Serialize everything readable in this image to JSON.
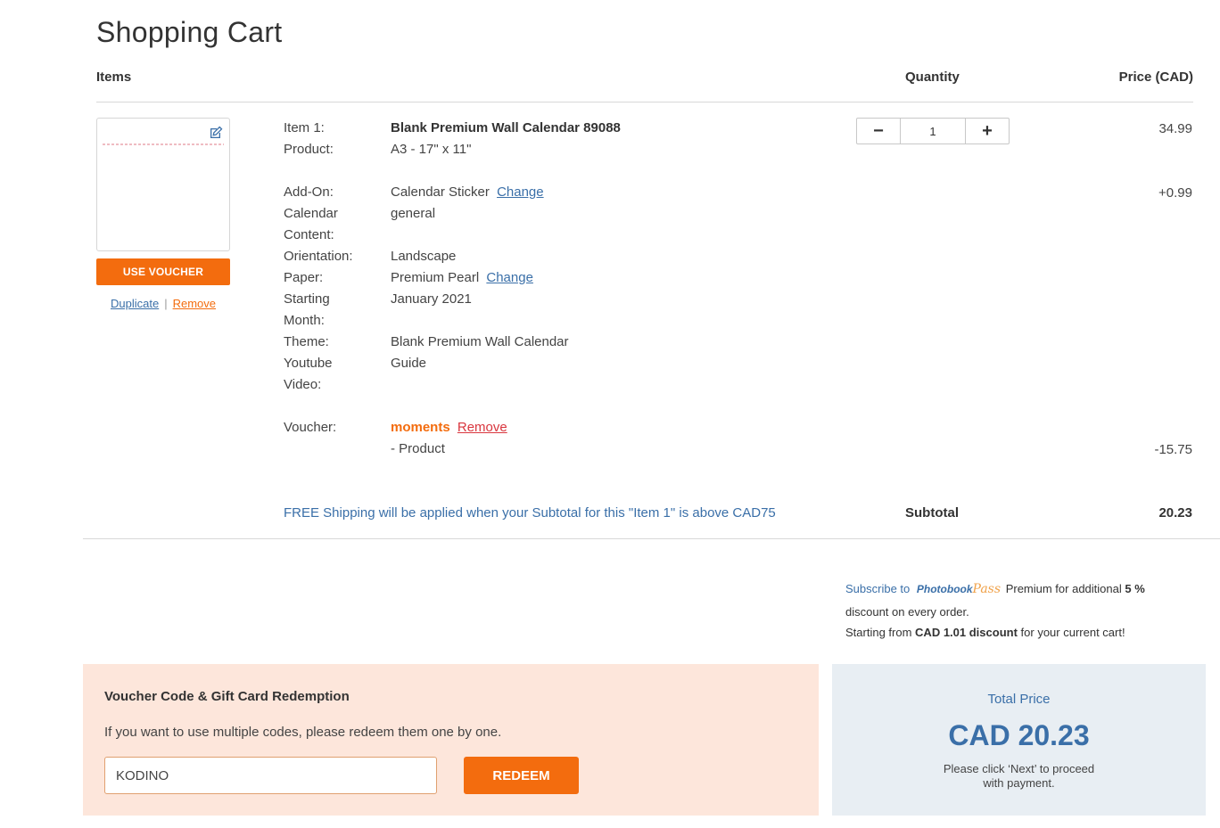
{
  "page": {
    "title": "Shopping Cart"
  },
  "table_headers": {
    "items": "Items",
    "quantity": "Quantity",
    "price": "Price (CAD)"
  },
  "item": {
    "actions": {
      "use_voucher": "USE VOUCHER",
      "duplicate": "Duplicate",
      "separator": "|",
      "remove": "Remove"
    },
    "item_label": "Item 1:",
    "item_name": "Blank Premium Wall Calendar 89088",
    "product_label": "Product:",
    "product_value": "A3 - 17\" x 11\"",
    "addon_label": "Add-On:",
    "addon_value": "Calendar Sticker",
    "addon_change": "Change",
    "calendar_content_label_1": "Calendar",
    "calendar_content_label_2": "Content:",
    "calendar_content_value": "general",
    "orientation_label": "Orientation:",
    "orientation_value": "Landscape",
    "paper_label": "Paper:",
    "paper_value": "Premium Pearl",
    "paper_change": "Change",
    "starting_month_label_1": "Starting",
    "starting_month_label_2": "Month:",
    "starting_month_value": "January 2021",
    "theme_label": "Theme:",
    "theme_value": "Blank Premium Wall Calendar",
    "youtube_label_1": "Youtube",
    "youtube_label_2": "Video:",
    "youtube_value": "Guide",
    "voucher_label": "Voucher:",
    "voucher_code": "moments",
    "voucher_remove": "Remove",
    "voucher_applies": "- Product",
    "quantity": {
      "minus": "−",
      "value": "1",
      "plus": "+"
    },
    "prices": {
      "base": "34.99",
      "addon": "+0.99",
      "voucher": "-15.75"
    },
    "free_shipping_note": "FREE Shipping will be applied when your Subtotal for this \"Item 1\" is above CAD75",
    "subtotal_label": "Subtotal",
    "subtotal_value": "20.23"
  },
  "promo": {
    "subscribe_to": "Subscribe to",
    "logo_text": "Photobook",
    "logo_pass": "Pass",
    "premium_text": "Premium for additional",
    "percent": "5 %",
    "line2": "discount on every order.",
    "starting_from": "Starting from",
    "discount_amount": "CAD 1.01 discount",
    "for_cart": "for your current cart!"
  },
  "voucher_panel": {
    "title": "Voucher Code & Gift Card Redemption",
    "subtitle": "If you want to use multiple codes, please redeem them one by one.",
    "input_value": "KODINO",
    "redeem_label": "REDEEM"
  },
  "total_panel": {
    "label": "Total Price",
    "amount": "CAD 20.23",
    "note_line1": "Please click ‘Next’ to proceed",
    "note_line2": "with payment."
  },
  "colors": {
    "accent_orange": "#f36c0e",
    "link_blue": "#3a6fa8",
    "voucher_bg": "#fde6db",
    "total_bg": "#e8eef3"
  }
}
